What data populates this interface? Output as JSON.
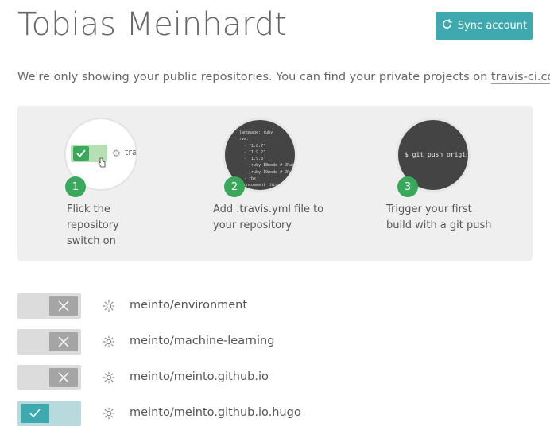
{
  "header": {
    "title": "Tobias Meinhardt",
    "sync_label": "Sync account",
    "accent_color": "#3eaaaf"
  },
  "note": {
    "text": "We're only showing your public repositories. You can find your private projects on ",
    "link": "travis-ci.com",
    "trailing": "."
  },
  "steps": [
    {
      "number": "1",
      "text": "Flick the repository switch on",
      "illustration": {
        "label": "tra"
      }
    },
    {
      "number": "2",
      "text": "Add .travis.yml file to your repository",
      "illustration": {
        "code": "language: ruby\nrvm:\n  - \"1.8.7\"\n  - \"1.9.2\"\n  - \"1.9.3\"\n  - jruby-18mode # JRub\n  - jruby-19mode # JRub\n  - rbx\n# uncomment this li\n# script: bundle"
      }
    },
    {
      "number": "3",
      "text": "Trigger your first build with a git push",
      "illustration": {
        "command": "$ git push origin"
      }
    }
  ],
  "repositories": [
    {
      "name": "meinto/environment",
      "enabled": false
    },
    {
      "name": "meinto/machine-learning",
      "enabled": false
    },
    {
      "name": "meinto/meinto.github.io",
      "enabled": false
    },
    {
      "name": "meinto/meinto.github.io.hugo",
      "enabled": true
    }
  ],
  "colors": {
    "step_badge": "#39a85b",
    "toggle_on": "#3eaaaf",
    "toggle_off_knob": "#a5a5a5"
  }
}
